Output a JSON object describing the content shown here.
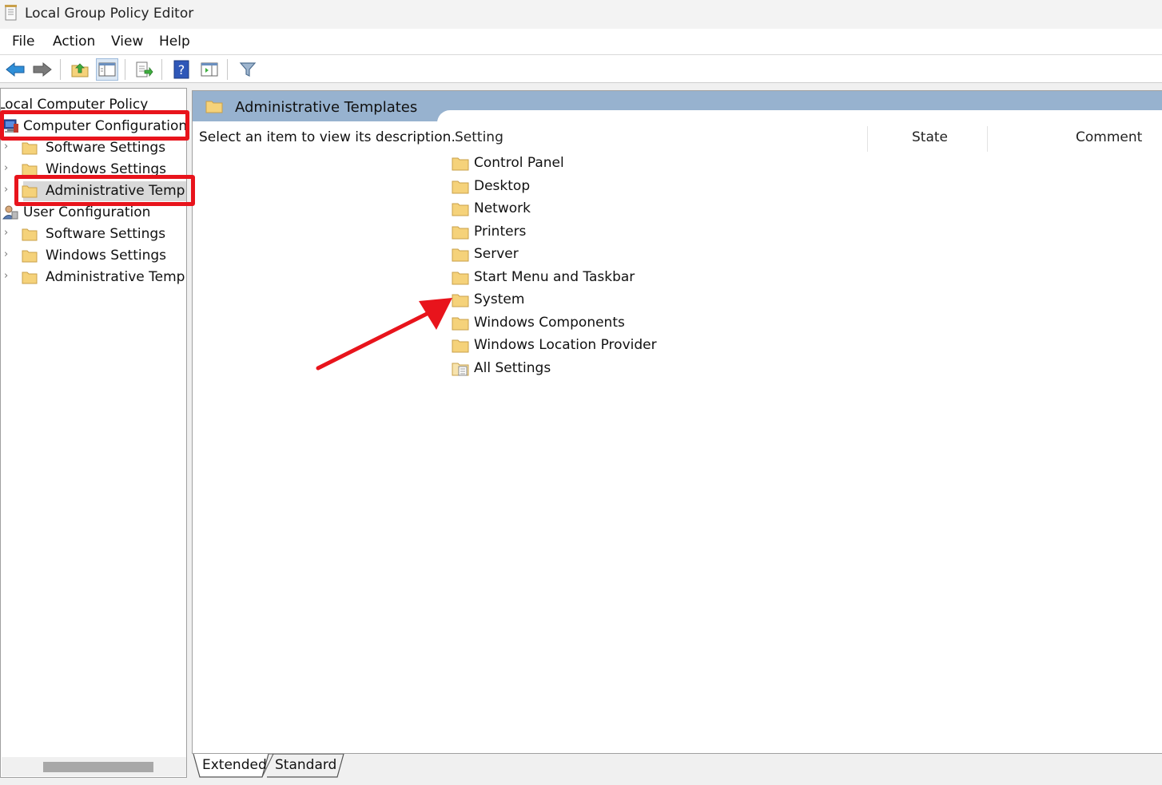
{
  "window": {
    "title": "Local Group Policy Editor"
  },
  "menu": {
    "items": [
      "File",
      "Action",
      "View",
      "Help"
    ]
  },
  "toolbar": {
    "buttons": [
      "back-icon",
      "forward-icon",
      "up-folder-icon",
      "show-hide-console-tree-icon",
      "export-list-icon",
      "help-icon",
      "show-action-pane-icon",
      "filter-icon"
    ]
  },
  "tree": {
    "root": "Local Computer Policy",
    "computer_configuration": "Computer Configuration",
    "cc_software_settings": "Software Settings",
    "cc_windows_settings": "Windows Settings",
    "cc_administrative_templates": "Administrative Templa",
    "user_configuration": "User Configuration",
    "uc_software_settings": "Software Settings",
    "uc_windows_settings": "Windows Settings",
    "uc_administrative_templates": "Administrative Templa"
  },
  "details": {
    "header_title": "Administrative Templates",
    "description": "Select an item to view its description.",
    "columns": {
      "setting": "Setting",
      "state": "State",
      "comment": "Comment"
    },
    "items": [
      "Control Panel",
      "Desktop",
      "Network",
      "Printers",
      "Server",
      "Start Menu and Taskbar",
      "System",
      "Windows Components",
      "Windows Location Provider",
      "All Settings"
    ]
  },
  "tabs": {
    "extended": "Extended",
    "standard": "Standard"
  },
  "colors": {
    "header_bar": "#97b2cf",
    "annotation": "#e8141c",
    "folder": "#f5d27a"
  }
}
